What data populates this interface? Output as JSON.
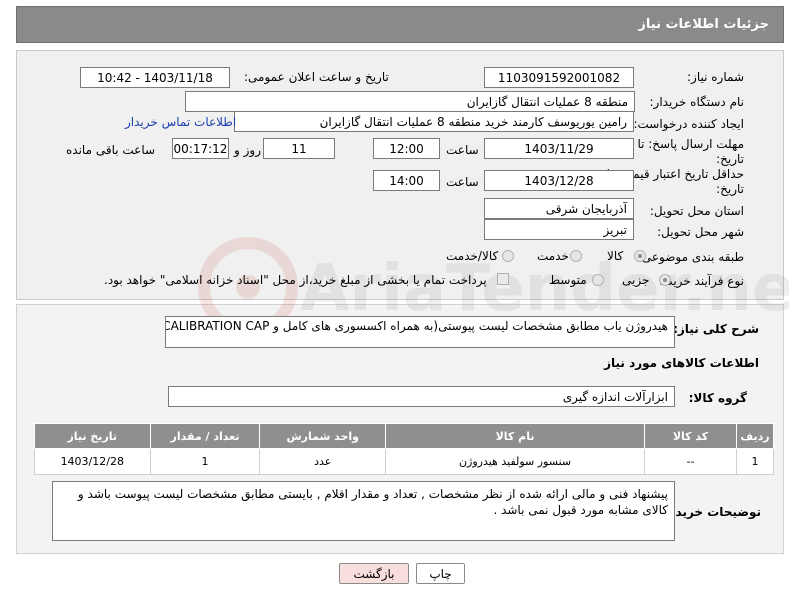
{
  "header": {
    "title": "جزئیات اطلاعات نیاز"
  },
  "form": {
    "need_number_label": "شماره نیاز:",
    "need_number": "1103091592001082",
    "announce_label": "تاریخ و ساعت اعلان عمومی:",
    "announce_value": "1403/11/18 - 10:42",
    "buyer_org_label": "نام دستگاه خریدار:",
    "buyer_org": "منطقه 8 عملیات انتقال گازایران",
    "requester_label": "ایجاد کننده درخواست:",
    "requester": "رامین یوریوسف کارمند خرید منطقه 8 عملیات انتقال گازایران",
    "contact_link": "اطلاعات تماس خریدار",
    "deadline_label_1": "مهلت ارسال پاسخ: تا",
    "deadline_label_2": "تاریخ:",
    "deadline_date": "1403/11/29",
    "time_label": "ساعت",
    "deadline_time": "12:00",
    "days_value": "11",
    "days_label": "روز و",
    "remaining_time": "00:17:12",
    "remaining_label": "ساعت باقی مانده",
    "validity_label_1": "حداقل تاریخ اعتبار قیمت: تا",
    "validity_label_2": "تاریخ:",
    "validity_date": "1403/12/28",
    "validity_time": "14:00",
    "province_label": "استان محل تحویل:",
    "province": "آذربایجان شرقی",
    "city_label": "شهر محل تحویل:",
    "city": "تبریز",
    "category_label": "طبقه بندی موضوعی:",
    "category_options": [
      "کالا",
      "خدمت",
      "کالا/خدمت"
    ],
    "purchase_type_label": "نوع فرآیند خرید :",
    "purchase_options": [
      "جزیی",
      "متوسط"
    ],
    "payment_note": "پرداخت تمام یا بخشی از مبلغ خرید،از محل \"اسناد خزانه اسلامی\" خواهد بود."
  },
  "details": {
    "description_label": "شرح کلی نیاز:",
    "description": "هیدروژن یاب مطابق مشخصات لیست پیوستی(به همراه اکسسوری های کامل و CALIBRATION CAP)",
    "goods_info_title": "اطلاعات کالاهای مورد نیاز",
    "goods_group_label": "گروه کالا:",
    "goods_group": "ابزارآلات اندازه گیری",
    "table": {
      "headers": [
        "ردیف",
        "کد کالا",
        "نام کالا",
        "واحد شمارش",
        "تعداد / مقدار",
        "تاریخ نیاز"
      ],
      "rows": [
        [
          "1",
          "--",
          "سنسور سولفید هیدروژن",
          "عدد",
          "1",
          "1403/12/28"
        ]
      ]
    },
    "buyer_notes_label": "توضیحات خریدار:",
    "buyer_notes": "پیشنهاد فنی و مالی ارائه شده از نظر مشخصات , تعداد و مقدار اقلام , بایستی مطابق مشخصات لیست پیوست باشد و کالای مشابه مورد قبول نمی باشد ."
  },
  "buttons": {
    "print": "چاپ",
    "back": "بازگشت"
  },
  "colors": {
    "header_bg": "#8a8a8a",
    "link": "#1a3fb0",
    "back_button_bg": "#f9dede"
  }
}
